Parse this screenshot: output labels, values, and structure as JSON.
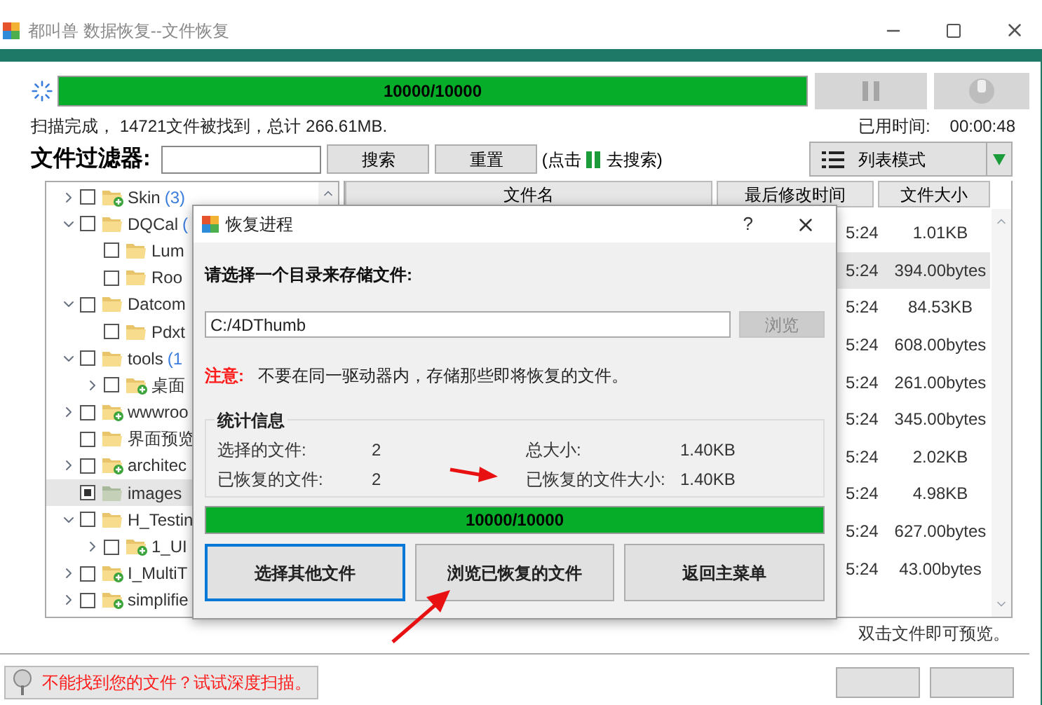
{
  "window": {
    "title": "都叫兽 数据恢复--文件恢复"
  },
  "scan": {
    "progress": {
      "level": 1,
      "text": "10000/10000"
    },
    "status": "扫描完成， 14721文件被找到，总计 266.61MB.",
    "elapsed_label": "已用时间:",
    "elapsed": "00:00:48"
  },
  "filter": {
    "label": "文件过滤器:",
    "search_button": "搜索",
    "reset_button": "重置",
    "hint_before": "(点击",
    "hint_after": "去搜索)",
    "view_mode": "列表模式"
  },
  "tree": [
    {
      "label": "Skin",
      "count": "(3)",
      "kind": "folder-plus",
      "expanded": false,
      "checked": false,
      "selected": false
    },
    {
      "label": "DQCal",
      "count": "(",
      "kind": "folder",
      "expanded": true,
      "checked": false,
      "selected": false,
      "children": [
        {
          "label": "Lum",
          "kind": "folder",
          "checked": false,
          "selected": false
        },
        {
          "label": "Roo",
          "kind": "folder",
          "checked": false,
          "selected": false
        }
      ]
    },
    {
      "label": "Datcom",
      "kind": "folder",
      "expanded": true,
      "checked": false,
      "selected": false,
      "children": [
        {
          "label": "Pdxt",
          "kind": "folder",
          "checked": false,
          "selected": false
        }
      ]
    },
    {
      "label": "tools",
      "count": "(1",
      "kind": "folder",
      "expanded": true,
      "checked": false,
      "selected": false,
      "children": [
        {
          "label": "桌面",
          "kind": "folder-plus",
          "expanded": false,
          "checked": false,
          "selected": false
        }
      ]
    },
    {
      "label": "wwwroo",
      "kind": "folder-plus",
      "expanded": false,
      "checked": false,
      "selected": false
    },
    {
      "label": "界面预览",
      "kind": "folder",
      "checked": false,
      "selected": false
    },
    {
      "label": "architec",
      "kind": "folder-plus",
      "expanded": false,
      "checked": false,
      "selected": false
    },
    {
      "label": "images",
      "kind": "folder-grey",
      "checked": true,
      "selected": true
    },
    {
      "label": "H_Testin",
      "kind": "folder",
      "expanded": true,
      "checked": false,
      "selected": false,
      "children": [
        {
          "label": "1_UI",
          "kind": "folder-plus",
          "expanded": false,
          "checked": false,
          "selected": false
        }
      ]
    },
    {
      "label": "I_MultiT",
      "kind": "folder-plus",
      "expanded": false,
      "checked": false,
      "selected": false
    },
    {
      "label": "simplifie",
      "kind": "folder-plus",
      "expanded": false,
      "checked": false,
      "selected": false
    }
  ],
  "table": {
    "columns": [
      "文件名",
      "最后修改时间",
      "文件大小"
    ],
    "rows": [
      {
        "time": "5:24",
        "size": "1.01KB",
        "selected": false
      },
      {
        "time": "5:24",
        "size": "394.00bytes",
        "selected": true
      },
      {
        "time": "5:24",
        "size": "84.53KB",
        "selected": false
      },
      {
        "time": "5:24",
        "size": "608.00bytes",
        "selected": false
      },
      {
        "time": "5:24",
        "size": "261.00bytes",
        "selected": false
      },
      {
        "time": "5:24",
        "size": "345.00bytes",
        "selected": false
      },
      {
        "time": "5:24",
        "size": "2.02KB",
        "selected": false
      },
      {
        "time": "5:24",
        "size": "4.98KB",
        "selected": false
      },
      {
        "time": "5:24",
        "size": "627.00bytes",
        "selected": false
      },
      {
        "time": "5:24",
        "size": "43.00bytes",
        "selected": false
      }
    ]
  },
  "preview_hint": "双击文件即可预览。",
  "deep_scan_button": "不能找到您的文件？试试深度扫描。",
  "dialog": {
    "title": "恢复进程",
    "help": "?",
    "prompt": "请选择一个目录来存储文件:",
    "path": "C:/4DThumb",
    "browse": {
      "label": "浏览",
      "disabled": true
    },
    "note_label": "注意:",
    "note": "不要在同一驱动器内，存储那些即将恢复的文件。",
    "stats_title": "统计信息",
    "stats_left": [
      {
        "label": "选择的文件:",
        "value": "2"
      },
      {
        "label": "已恢复的文件:",
        "value": "2"
      }
    ],
    "stats_right": [
      {
        "label": "总大小:",
        "value": "1.40KB"
      },
      {
        "label": "已恢复的文件大小:",
        "value": "1.40KB"
      }
    ],
    "progress": {
      "level": 1,
      "text": "10000/10000"
    },
    "buttons": [
      {
        "label": "选择其他文件",
        "focused": true
      },
      {
        "label": "浏览已恢复的文件",
        "focused": false
      },
      {
        "label": "返回主菜单",
        "focused": false
      }
    ]
  }
}
